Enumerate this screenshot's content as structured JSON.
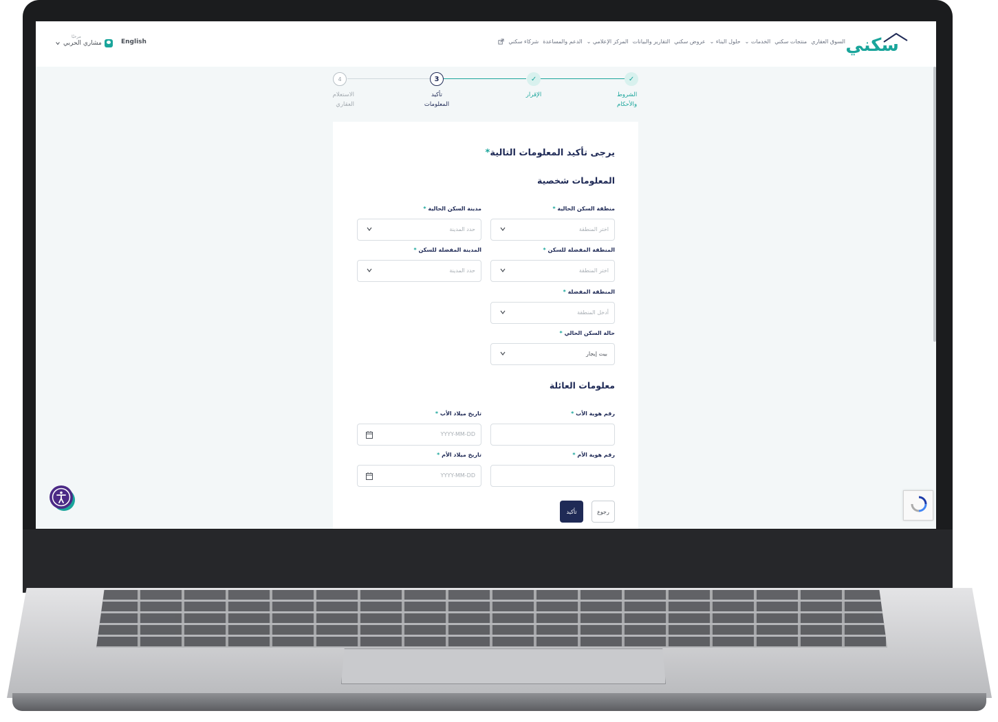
{
  "header": {
    "logo": "سكني",
    "nav": [
      "السوق العقاري",
      "منتجات سكني",
      "الخدمات ⌄",
      "حلول البناء ⌄",
      "عروض سكني",
      "التقارير والبيانات",
      "المركز الإعلامي ⌄",
      "الدعم والمساعدة",
      "شركاء سكني"
    ],
    "language": "English",
    "greeting": "مرحبًا",
    "user_name": "مشاري الحربي"
  },
  "stepper": [
    {
      "number": "✓",
      "label_line1": "الشروط",
      "label_line2": "والأحكام",
      "state": "done"
    },
    {
      "number": "✓",
      "label_line1": "الإقرار",
      "label_line2": "",
      "state": "done"
    },
    {
      "number": "3",
      "label_line1": "تأكيد",
      "label_line2": "المعلومات",
      "state": "current"
    },
    {
      "number": "4",
      "label_line1": "الاستعلام",
      "label_line2": "العقاري",
      "state": "upcoming"
    }
  ],
  "form": {
    "heading": "يرجى تأكيد المعلومات التالية",
    "personal_title": "المعلومات شخصية",
    "family_title": "معلومات العائلة",
    "fields": {
      "current_region": {
        "label": "منطقة السكن الحالية",
        "placeholder": "اختر المنطقة"
      },
      "current_city": {
        "label": "مدينة السكن الحالية",
        "placeholder": "حدد المدينة"
      },
      "preferred_region": {
        "label": "المنطقة المفضلة للسكن",
        "placeholder": "اختر المنطقة"
      },
      "preferred_city": {
        "label": "المدينة المفضلة للسكن",
        "placeholder": "حدد المدينة"
      },
      "preferred_area": {
        "label": "المنطقة المفضلة",
        "placeholder": "أدخل المنطقة"
      },
      "housing_status": {
        "label": "حالة السكن الحالي",
        "value": "بيت إيجار"
      },
      "father_id": {
        "label": "رقم هوية الأب",
        "placeholder": ""
      },
      "father_dob": {
        "label": "تاريخ ميلاد الأب",
        "placeholder": "YYYY-MM-DD"
      },
      "mother_id": {
        "label": "رقم هوية الأم",
        "placeholder": ""
      },
      "mother_dob": {
        "label": "تاريخ ميلاد الأم",
        "placeholder": "YYYY-MM-DD"
      }
    },
    "confirm_label": "تأكيد",
    "back_label": "رجوع"
  },
  "colors": {
    "accent": "#1aa59b",
    "primary": "#1f2a56",
    "background": "#f3f7f8"
  }
}
